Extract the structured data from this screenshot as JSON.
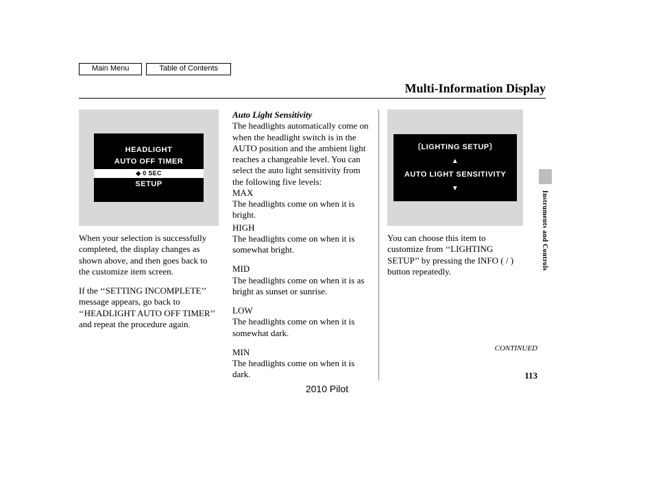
{
  "nav": {
    "main_menu": "Main Menu",
    "toc": "Table of Contents"
  },
  "header": {
    "title": "Multi-Information Display"
  },
  "lcd1": {
    "line1": "HEADLIGHT",
    "line2": "AUTO OFF TIMER",
    "value": "◆ 0 SEC",
    "line3": "SETUP"
  },
  "col1": {
    "p1": "When your selection is successfully completed, the display changes as shown above, and then goes back to the customize item screen.",
    "p2": "If the ‘‘SETTING INCOMPLETE’’ message appears, go back to ‘‘HEADLIGHT AUTO OFF TIMER’’ and repeat the procedure again."
  },
  "col2": {
    "title": "Auto Light Sensitivity",
    "intro": "The headlights automatically come on when the headlight switch is in the AUTO position and the ambient light reaches a changeable level. You can select the auto light sensitivity from the following five levels:",
    "max_h": "MAX",
    "max_t": "The headlights come on when it is bright.",
    "high_h": "HIGH",
    "high_t": "The headlights come on when it is somewhat bright.",
    "mid_h": "MID",
    "mid_t": "The headlights come on when it is as bright as sunset or sunrise.",
    "low_h": "LOW",
    "low_t": "The headlights come on when it is somewhat dark.",
    "min_h": "MIN",
    "min_t": "The headlights come on when it is dark."
  },
  "lcd2": {
    "title": "〔LIGHTING SETUP〕",
    "up": "▲",
    "label": "AUTO LIGHT SENSITIVITY",
    "down": "▼"
  },
  "col3": {
    "p1": "You can choose this item to customize from ‘‘LIGHTING SETUP’’ by pressing the INFO (    /     ) button repeatedly."
  },
  "side": {
    "section": "Instruments and Controls"
  },
  "footer": {
    "continued": "CONTINUED",
    "page": "113",
    "model": "2010 Pilot"
  }
}
